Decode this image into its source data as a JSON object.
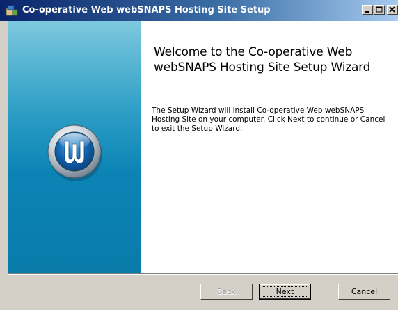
{
  "window": {
    "title": "Co-operative Web webSNAPS Hosting Site Setup",
    "icon": "installer-icon",
    "controls": [
      "minimize",
      "maximize",
      "close"
    ]
  },
  "banner": {
    "logo_letter": "W",
    "logo_icon": "cooperative-web-logo-icon",
    "colors": {
      "top": "#7ec9df",
      "bottom": "#0a7bab"
    }
  },
  "main": {
    "heading": "Welcome to the Co-operative Web webSNAPS Hosting Site Setup Wizard",
    "body": "The Setup Wizard will install Co-operative Web webSNAPS Hosting Site on your computer. Click Next to continue or Cancel to exit the Setup Wizard."
  },
  "footer": {
    "back_label": "Back",
    "next_label": "Next",
    "cancel_label": "Cancel",
    "back_enabled": false
  }
}
